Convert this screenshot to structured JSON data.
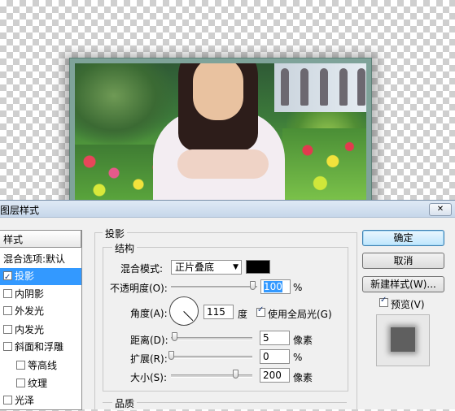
{
  "dialog": {
    "title": "图层样式",
    "close_icon": "close-icon"
  },
  "styles_panel": {
    "header": "样式",
    "items": [
      {
        "label": "混合选项:默认",
        "checkbox": false
      },
      {
        "label": "投影",
        "checkbox": true,
        "checked": true,
        "selected": true
      },
      {
        "label": "内阴影",
        "checkbox": true,
        "checked": false
      },
      {
        "label": "外发光",
        "checkbox": true,
        "checked": false
      },
      {
        "label": "内发光",
        "checkbox": true,
        "checked": false
      },
      {
        "label": "斜面和浮雕",
        "checkbox": true,
        "checked": false
      },
      {
        "label": "等高线",
        "checkbox": true,
        "checked": false,
        "indent": true
      },
      {
        "label": "纹理",
        "checkbox": true,
        "checked": false,
        "indent": true
      },
      {
        "label": "光泽",
        "checkbox": true,
        "checked": false
      }
    ]
  },
  "drop_shadow": {
    "group_label": "投影",
    "structure_label": "结构",
    "blend_mode_label": "混合模式:",
    "blend_mode_value": "正片叠底",
    "shadow_color": "#000000",
    "opacity_label": "不透明度(O):",
    "opacity_value": "100",
    "opacity_unit": "%",
    "angle_label": "角度(A):",
    "angle_value": "115",
    "angle_unit": "度",
    "global_light_label": "使用全局光(G)",
    "global_light_checked": true,
    "distance_label": "距离(D):",
    "distance_value": "5",
    "distance_unit": "像素",
    "spread_label": "扩展(R):",
    "spread_value": "0",
    "spread_unit": "%",
    "size_label": "大小(S):",
    "size_value": "200",
    "size_unit": "像素",
    "quality_label": "品质"
  },
  "buttons": {
    "ok": "确定",
    "cancel": "取消",
    "new_style": "新建样式(W)...",
    "preview_label": "预览(V)",
    "preview_checked": true
  }
}
